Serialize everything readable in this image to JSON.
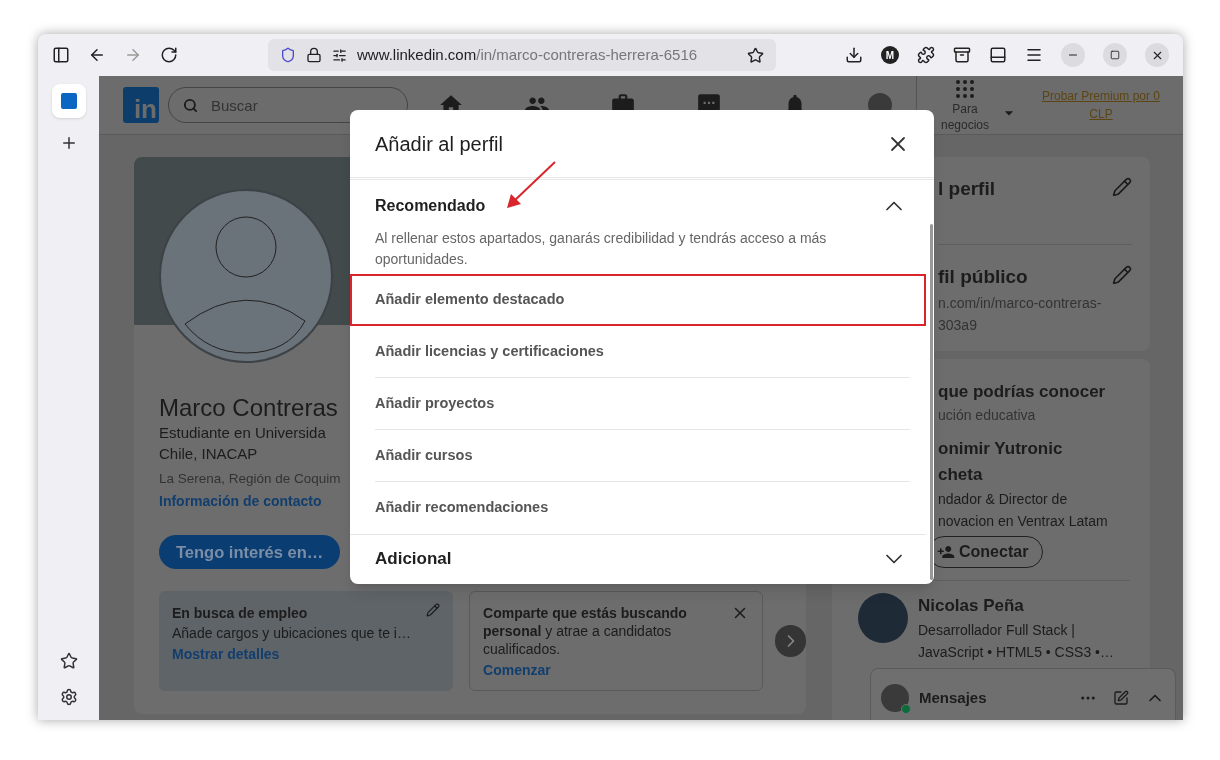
{
  "browser": {
    "nav": [
      {
        "kind": "back",
        "disabled": false
      },
      {
        "kind": "forward",
        "disabled": true
      },
      {
        "kind": "reload",
        "disabled": false
      }
    ],
    "url_host": "www.linkedin.com",
    "url_path": "/in/marco-contreras-herrera-6516",
    "account_initial": "M"
  },
  "linkedin": {
    "logo": "in",
    "search": {
      "placeholder": "Buscar"
    },
    "business": "Para negocios",
    "premium_link": "Probar Premium por 0 CLP"
  },
  "profile": {
    "name": "Marco Contreras",
    "headline": [
      "Estudiante en Universida",
      "Chile, INACAP"
    ],
    "location": "La Serena, Región de Coquim",
    "contact_link": "Información de contacto",
    "interest_button": "Tengo interés en…",
    "cards": [
      {
        "kind": "edit",
        "title": "En busca de empleo",
        "text": "Añade cargos y ubicaciones que te i…",
        "link": "Mostrar detalles"
      },
      {
        "kind": "dismiss",
        "text": "**Comparte que estás buscando personal** y atrae a candidatos cualificados.",
        "link": "Comenzar"
      }
    ]
  },
  "sidebar": {
    "profile_language": "l perfil",
    "public_profile": "fil público",
    "public_url": [
      "n.com/in/marco-contreras-",
      "303a9"
    ],
    "people_title": "que podrías conocer",
    "people_subtitle": "ución educativa",
    "people": [
      {
        "name": [
          "onimir Yutronic",
          "cheta"
        ],
        "headline": [
          "ndador & Director de",
          "novacion en Ventrax Latam"
        ],
        "button": "Conectar"
      },
      {
        "name": [
          "Nicolas Peña"
        ],
        "headline": [
          "Desarrollador Full Stack |",
          "JavaScript • HTML5 • CSS3 •…"
        ]
      }
    ]
  },
  "messaging": {
    "title": "Mensajes",
    "online": true
  },
  "modal": {
    "title": "Añadir al perfil",
    "sections": [
      {
        "title": "Recomendado",
        "expanded": true,
        "description": "Al rellenar estos apartados, ganarás credibilidad y tendrás acceso a más oportunidades.",
        "items": [
          {
            "label": "Añadir elemento destacado",
            "highlighted": true
          },
          {
            "label": "Añadir licencias y certificaciones",
            "highlighted": false
          },
          {
            "label": "Añadir proyectos",
            "highlighted": false
          },
          {
            "label": "Añadir cursos",
            "highlighted": false
          },
          {
            "label": "Añadir recomendaciones",
            "highlighted": false
          }
        ]
      },
      {
        "title": "Adicional",
        "expanded": false
      }
    ]
  }
}
